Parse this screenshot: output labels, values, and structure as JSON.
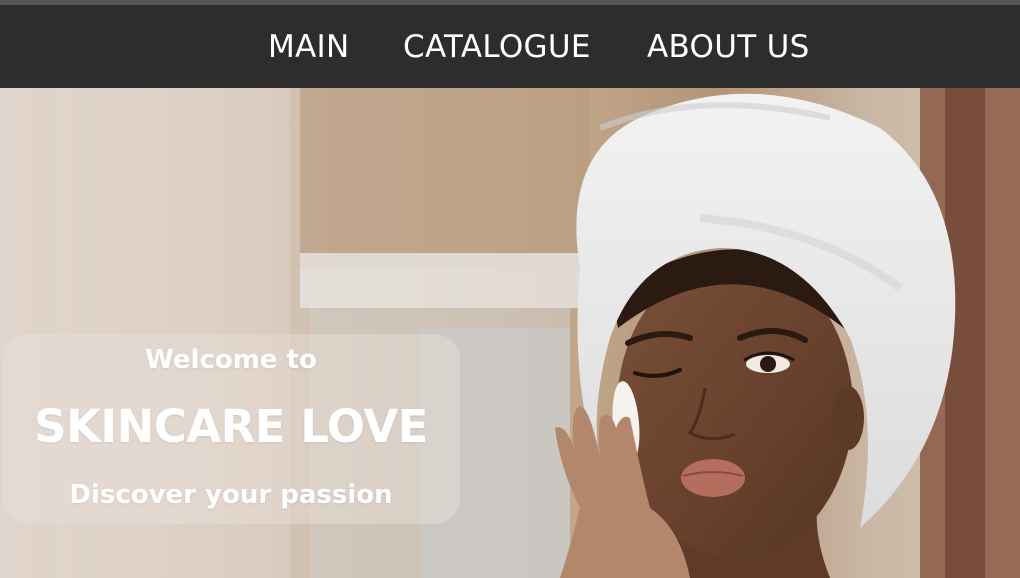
{
  "nav": {
    "items": [
      {
        "label": "MAIN"
      },
      {
        "label": "CATALOGUE"
      },
      {
        "label": "ABOUT US"
      }
    ]
  },
  "hero": {
    "welcome": "Welcome to",
    "title": "SKINCARE LOVE",
    "tagline": "Discover your passion"
  },
  "colors": {
    "navbar": "#2d2d2d",
    "nav_text": "#ffffff",
    "hero_text": "#ffffff"
  }
}
